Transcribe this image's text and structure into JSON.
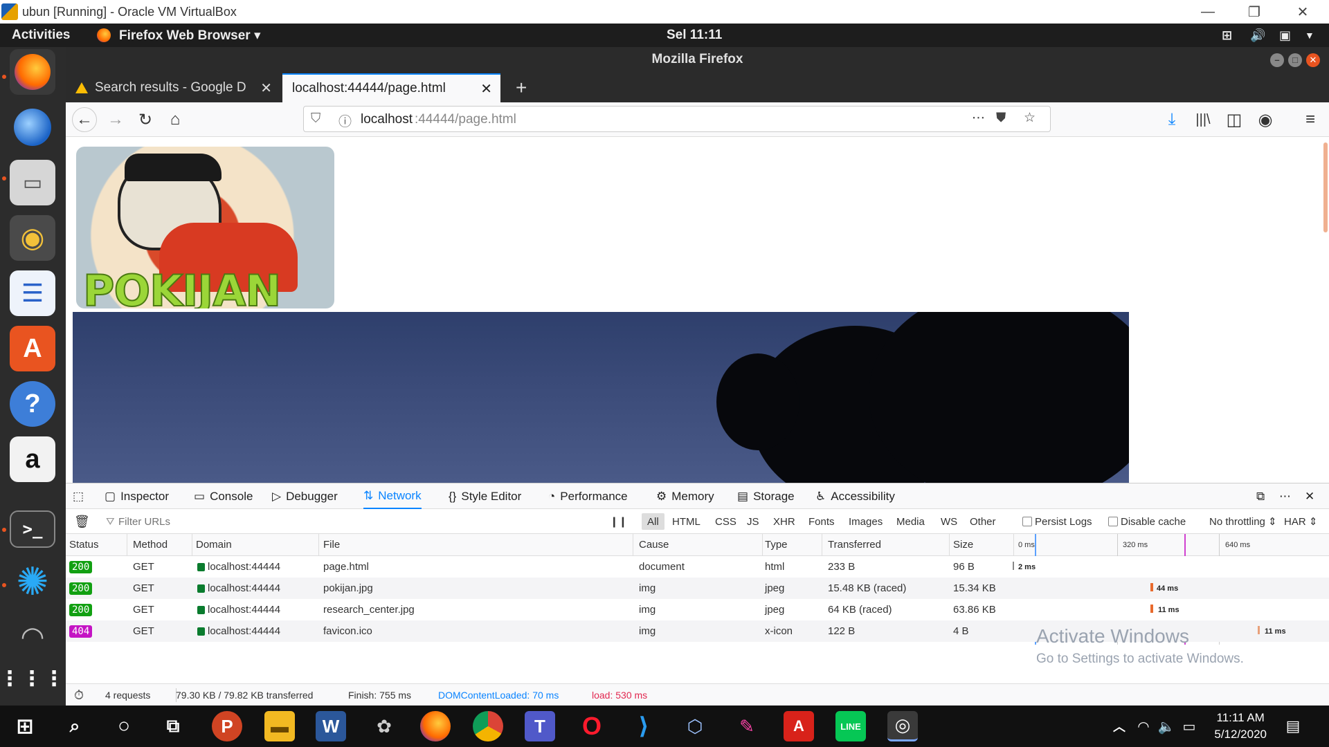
{
  "vbox": {
    "title": "ubun [Running] - Oracle VM VirtualBox",
    "minimize": "—",
    "restore": "❐",
    "close": "✕"
  },
  "gnome": {
    "activities": "Activities",
    "app_menu": "Firefox Web Browser ▾",
    "clock": "Sel 11:11"
  },
  "firefox": {
    "window_title": "Mozilla Firefox",
    "tabs": [
      {
        "label": "Search results - Google D",
        "active": false
      },
      {
        "label": "localhost:44444/page.html",
        "active": true
      }
    ],
    "new_tab": "+",
    "url_host": "localhost",
    "url_rest": ":44444/page.html"
  },
  "page": {
    "logo_text": "POKIJAN"
  },
  "devtools": {
    "tabs": [
      "Inspector",
      "Console",
      "Debugger",
      "Network",
      "Style Editor",
      "Performance",
      "Memory",
      "Storage",
      "Accessibility"
    ],
    "active_tab": "Network",
    "filter_placeholder": "Filter URLs",
    "type_filters": [
      "All",
      "HTML",
      "CSS",
      "JS",
      "XHR",
      "Fonts",
      "Images",
      "Media",
      "WS",
      "Other"
    ],
    "persist_logs": "Persist Logs",
    "disable_cache": "Disable cache",
    "throttling": "No throttling ⇕",
    "har": "HAR ⇕",
    "columns": [
      "Status",
      "Method",
      "Domain",
      "File",
      "Cause",
      "Type",
      "Transferred",
      "Size"
    ],
    "waterfall_ticks": [
      "0 ms",
      "320 ms",
      "640 ms"
    ],
    "rows": [
      {
        "status": "200",
        "method": "GET",
        "domain": "localhost:44444",
        "file": "page.html",
        "cause": "document",
        "type": "html",
        "transferred": "233 B",
        "size": "96 B",
        "timing": "2 ms"
      },
      {
        "status": "200",
        "method": "GET",
        "domain": "localhost:44444",
        "file": "pokijan.jpg",
        "cause": "img",
        "type": "jpeg",
        "transferred": "15.48 KB (raced)",
        "size": "15.34 KB",
        "timing": "44 ms"
      },
      {
        "status": "200",
        "method": "GET",
        "domain": "localhost:44444",
        "file": "research_center.jpg",
        "cause": "img",
        "type": "jpeg",
        "transferred": "64 KB (raced)",
        "size": "63.86 KB",
        "timing": "11 ms"
      },
      {
        "status": "404",
        "method": "GET",
        "domain": "localhost:44444",
        "file": "favicon.ico",
        "cause": "img",
        "type": "x-icon",
        "transferred": "122 B",
        "size": "4 B",
        "timing": "11 ms"
      }
    ],
    "summary": {
      "requests": "4 requests",
      "transferred": "79.30 KB / 79.82 KB transferred",
      "finish": "Finish: 755 ms",
      "dom_loaded": "DOMContentLoaded: 70 ms",
      "load": "load: 530 ms"
    }
  },
  "watermark": {
    "line1": "Activate Windows",
    "line2": "Go to Settings to activate Windows."
  },
  "taskbar": {
    "time": "11:11 AM",
    "date": "5/12/2020"
  },
  "colors": {
    "ok": "#12a012",
    "not_found": "#c414c4",
    "active_tab": "#0a84ff",
    "dom_loaded": "#0a84ff",
    "load": "#e22850",
    "gnome_accent": "#e95420"
  }
}
